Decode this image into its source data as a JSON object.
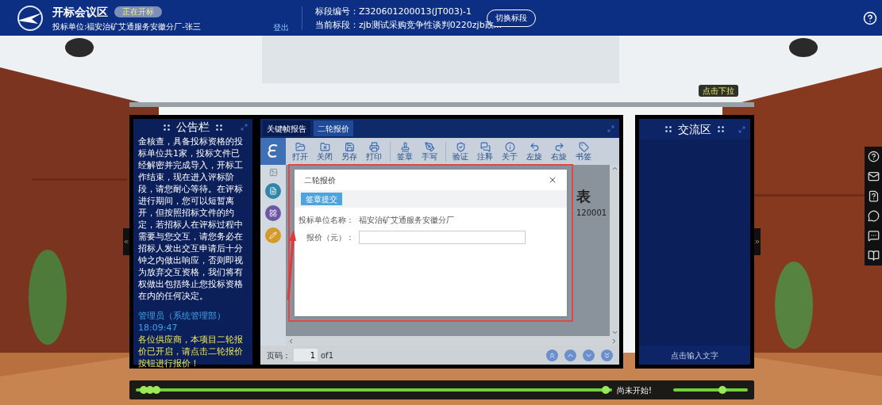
{
  "header": {
    "title": "开标会议区",
    "status": "正在开标",
    "bidder": "投标单位:福安治矿艾通服务安徽分厂-张三",
    "logout": "登出",
    "section_label": "标段编号：",
    "section_no": "Z320601200013(JT003)-1",
    "current_label": "当前标段：",
    "current": "zjb测试采购竞争性谈判0220zjb政...",
    "switch_button": "切换标段"
  },
  "tooltip": "点击下拉",
  "notice_panel": {
    "title": "公告栏",
    "body": "金核查，具备投标资格的投标单位共1家，投标文件已经解密并完成导入，开标工作结束，现在进入评标阶段，请您耐心等待。在评标进行期间，您可以短暂离开，但按照招标文件的约定，若招标人在评标过程中需要与您交互，请您务必在招标人发出交互申请后十分钟之内做出响应，否则即视为放弃交互资格，我们将有权做出包括终止您投标资格在内的任何决定。",
    "messages": [
      {
        "sender": "管理员（系统管理部）18:09:47",
        "text": "各位供应商，本项目二轮报价已开启，请点击二轮报价按钮进行报价！"
      }
    ]
  },
  "viewer": {
    "tabs": [
      {
        "label": "关键帧报告",
        "selected": false
      },
      {
        "label": "二轮报价",
        "selected": true
      }
    ],
    "toolbar": [
      [
        {
          "label": "打开"
        },
        {
          "label": "关闭"
        },
        {
          "label": "另存"
        },
        {
          "label": "打印"
        }
      ],
      [
        {
          "label": "签章"
        },
        {
          "label": "手写"
        }
      ],
      [
        {
          "label": "验证"
        },
        {
          "label": "注释"
        },
        {
          "label": "关于"
        },
        {
          "label": "左旋"
        },
        {
          "label": "右旋"
        },
        {
          "label": "书签"
        }
      ]
    ],
    "document": {
      "heading": "表",
      "code": "120001"
    },
    "pager": {
      "label": "页码：",
      "page": "1",
      "total": "of1"
    },
    "dialog": {
      "title": "二轮报价",
      "submit_button": "签章提交",
      "fields": [
        {
          "kind": "text",
          "label": "投标单位名称：",
          "value": "福安治矿艾通服务安徽分厂"
        },
        {
          "kind": "input",
          "label": "报价（元）："
        }
      ]
    }
  },
  "chat_panel": {
    "title": "交流区",
    "input_hint": "点击输入文字"
  },
  "timeline": {
    "status": "尚未开始!"
  }
}
